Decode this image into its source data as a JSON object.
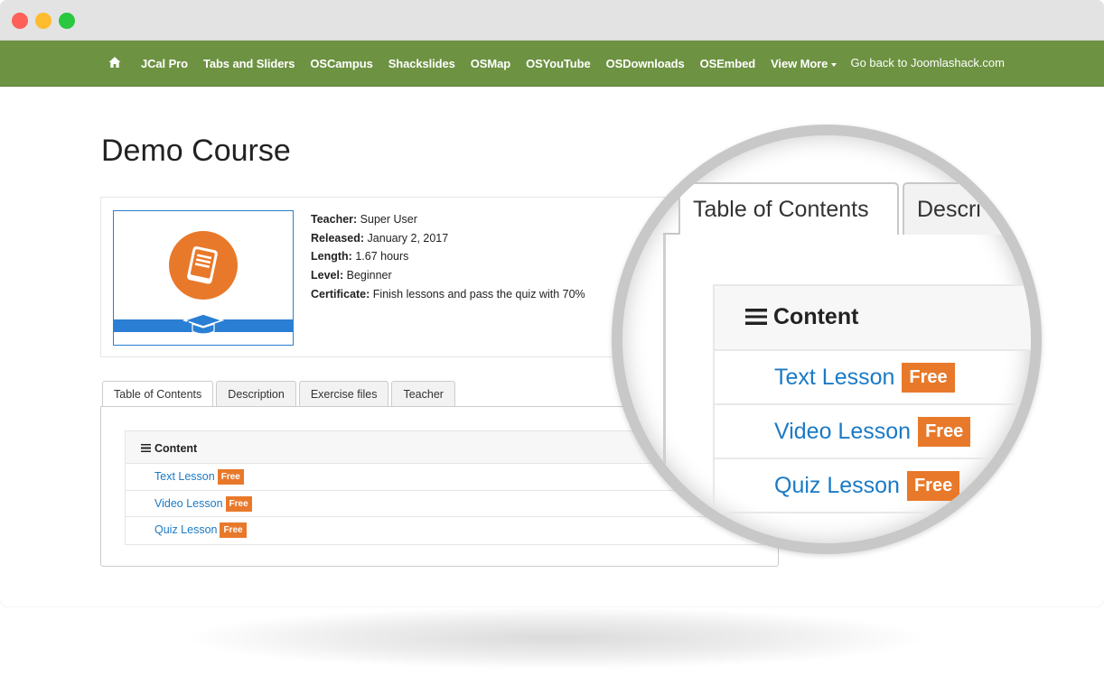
{
  "nav": {
    "items": [
      {
        "label": "JCal Pro"
      },
      {
        "label": "Tabs and Sliders"
      },
      {
        "label": "OSCampus"
      },
      {
        "label": "Shackslides"
      },
      {
        "label": "OSMap"
      },
      {
        "label": "OSYouTube"
      },
      {
        "label": "OSDownloads"
      },
      {
        "label": "OSEmbed"
      },
      {
        "label": "View More"
      }
    ],
    "back_link": "Go back to Joomlashack.com",
    "background_color": "#6d9242"
  },
  "page": {
    "title": "Demo Course"
  },
  "course": {
    "teacher_label": "Teacher:",
    "teacher_value": "Super User",
    "released_label": "Released:",
    "released_value": "January 2, 2017",
    "length_label": "Length:",
    "length_value": "1.67 hours",
    "level_label": "Level:",
    "level_value": "Beginner",
    "certificate_label": "Certificate:",
    "certificate_value": "Finish lessons and pass the quiz with 70%",
    "thumbnail_icons": [
      "book-icon",
      "graduation-cap-icon"
    ],
    "accent_orange": "#e8792a",
    "accent_blue": "#2a7fd4"
  },
  "tabs": [
    {
      "label": "Table of Contents",
      "active": true
    },
    {
      "label": "Description",
      "active": false
    },
    {
      "label": "Exercise files",
      "active": false
    },
    {
      "label": "Teacher",
      "active": false
    }
  ],
  "contents": {
    "heading": "Content",
    "lessons": [
      {
        "title": "Text Lesson",
        "badge": "Free"
      },
      {
        "title": "Video Lesson",
        "badge": "Free"
      },
      {
        "title": "Quiz Lesson",
        "badge": "Free"
      }
    ]
  },
  "magnifier": {
    "tab_active": "Table of Contents",
    "tab_other": "Descri"
  }
}
